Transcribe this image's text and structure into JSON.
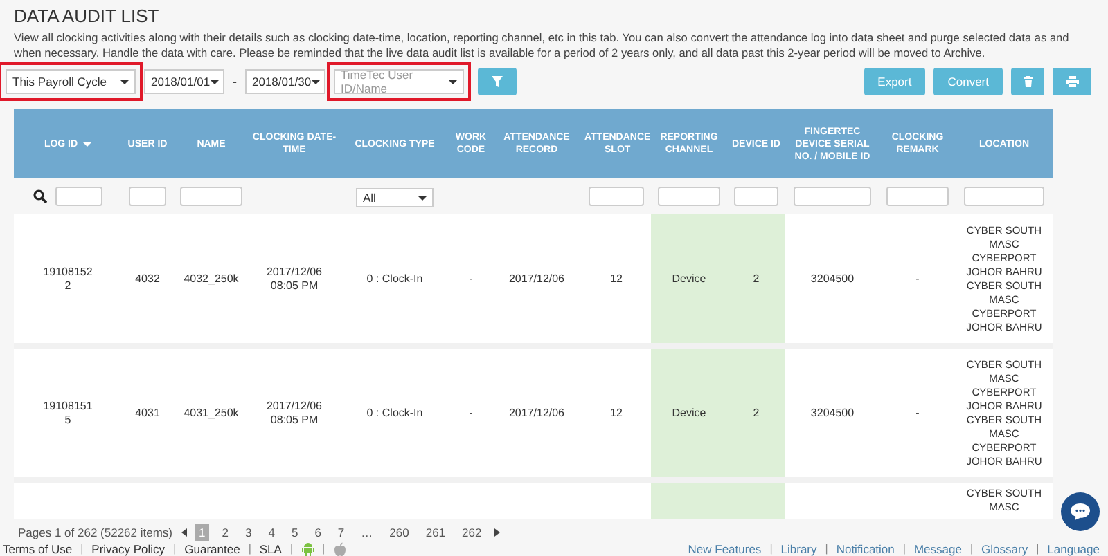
{
  "title": "DATA AUDIT LIST",
  "description": "View all clocking activities along with their details such as clocking date-time, location, reporting channel, etc in this tab. You can also convert the attendance log into data sheet and purge selected data as and when necessary. Handle the data with care. Please be reminded that the live data audit list is available for a period of 2 years only, and all data past this 2-year period will be moved to Archive.",
  "filters": [
    {
      "kind": "select",
      "value": "This Payroll Cycle",
      "highlighted": true
    },
    {
      "kind": "select",
      "value": "2018/01/01",
      "highlighted": false
    },
    {
      "kind": "separator",
      "value": "-"
    },
    {
      "kind": "select",
      "value": "2018/01/30",
      "highlighted": false
    },
    {
      "kind": "select",
      "placeholder": "TimeTec User ID/Name",
      "highlighted": true
    },
    {
      "kind": "filter-button"
    }
  ],
  "actions": [
    {
      "kind": "text",
      "label": "Export"
    },
    {
      "kind": "text",
      "label": "Convert"
    },
    {
      "kind": "trash"
    },
    {
      "kind": "print"
    }
  ],
  "table": {
    "columns": [
      {
        "label": "LOG ID",
        "sorted": true,
        "highlighted": false,
        "filter": {
          "kind": "input"
        }
      },
      {
        "label": "USER ID",
        "highlighted": false,
        "filter": {
          "kind": "input"
        }
      },
      {
        "label": "NAME",
        "highlighted": false,
        "filter": {
          "kind": "input"
        }
      },
      {
        "label": "CLOCKING DATE-TIME",
        "highlighted": false
      },
      {
        "label": "CLOCKING TYPE",
        "highlighted": false,
        "filter": {
          "kind": "dropdown",
          "value": "All"
        }
      },
      {
        "label": "WORK CODE",
        "highlighted": false
      },
      {
        "label": "ATTENDANCE RECORD",
        "highlighted": false
      },
      {
        "label": "ATTENDANCE SLOT",
        "highlighted": false,
        "filter": {
          "kind": "input"
        }
      },
      {
        "label": "REPORTING CHANNEL",
        "highlighted": true,
        "filter": {
          "kind": "input"
        }
      },
      {
        "label": "DEVICE ID",
        "highlighted": true,
        "filter": {
          "kind": "input"
        }
      },
      {
        "label": "FINGERTEC DEVICE SERIAL NO. / MOBILE ID",
        "highlighted": false,
        "filter": {
          "kind": "input"
        }
      },
      {
        "label": "CLOCKING REMARK",
        "highlighted": false,
        "filter": {
          "kind": "input"
        }
      },
      {
        "label": "LOCATION",
        "highlighted": false,
        "filter": {
          "kind": "input"
        }
      }
    ],
    "rows": [
      {
        "cells": [
          "191081522",
          "4032",
          "4032_250k",
          "2017/12/06 08:05 PM",
          "0 : Clock-In",
          "-",
          "2017/12/06",
          "12",
          "Device",
          "2",
          "3204500",
          "-",
          "CYBER SOUTH MASC CYBERPORT JOHOR BAHRU CYBER SOUTH MASC CYBERPORT JOHOR BAHRU"
        ]
      },
      {
        "cells": [
          "191081515",
          "4031",
          "4031_250k",
          "2017/12/06 08:05 PM",
          "0 : Clock-In",
          "-",
          "2017/12/06",
          "12",
          "Device",
          "2",
          "3204500",
          "-",
          "CYBER SOUTH MASC CYBERPORT JOHOR BAHRU CYBER SOUTH MASC CYBERPORT JOHOR BAHRU"
        ]
      },
      {
        "cells": [
          null,
          null,
          null,
          null,
          null,
          null,
          null,
          null,
          null,
          null,
          null,
          null,
          "CYBER SOUTH MASC"
        ]
      }
    ]
  },
  "pagination": {
    "summary": "Pages 1 of 262 (52262 items)",
    "pages": [
      {
        "label": "1",
        "selected": true
      },
      {
        "label": "2",
        "selected": false
      },
      {
        "label": "3",
        "selected": false
      },
      {
        "label": "4",
        "selected": false
      },
      {
        "label": "5",
        "selected": false
      },
      {
        "label": "6",
        "selected": false
      },
      {
        "label": "7",
        "selected": false
      },
      {
        "label": "…",
        "selected": false
      },
      {
        "label": "260",
        "selected": false
      },
      {
        "label": "261",
        "selected": false
      },
      {
        "label": "262",
        "selected": false
      }
    ]
  },
  "footer": {
    "left": [
      {
        "kind": "link",
        "label": "Terms of Use"
      },
      {
        "kind": "separator",
        "label": "|"
      },
      {
        "kind": "link",
        "label": "Privacy Policy"
      },
      {
        "kind": "separator",
        "label": "|"
      },
      {
        "kind": "link",
        "label": "Guarantee"
      },
      {
        "kind": "separator",
        "label": "|"
      },
      {
        "kind": "link",
        "label": "SLA"
      },
      {
        "kind": "separator",
        "label": "|"
      },
      {
        "kind": "android"
      },
      {
        "kind": "separator",
        "label": "|"
      },
      {
        "kind": "apple"
      }
    ],
    "right": [
      {
        "kind": "link",
        "label": "New Features"
      },
      {
        "kind": "separator",
        "label": "|"
      },
      {
        "kind": "link",
        "label": "Library"
      },
      {
        "kind": "separator",
        "label": "|"
      },
      {
        "kind": "link",
        "label": "Notification"
      },
      {
        "kind": "separator",
        "label": "|"
      },
      {
        "kind": "link",
        "label": "Message"
      },
      {
        "kind": "separator",
        "label": "|"
      },
      {
        "kind": "link",
        "label": "Glossary"
      },
      {
        "kind": "separator",
        "label": "|"
      },
      {
        "kind": "link",
        "label": "Language"
      }
    ]
  }
}
